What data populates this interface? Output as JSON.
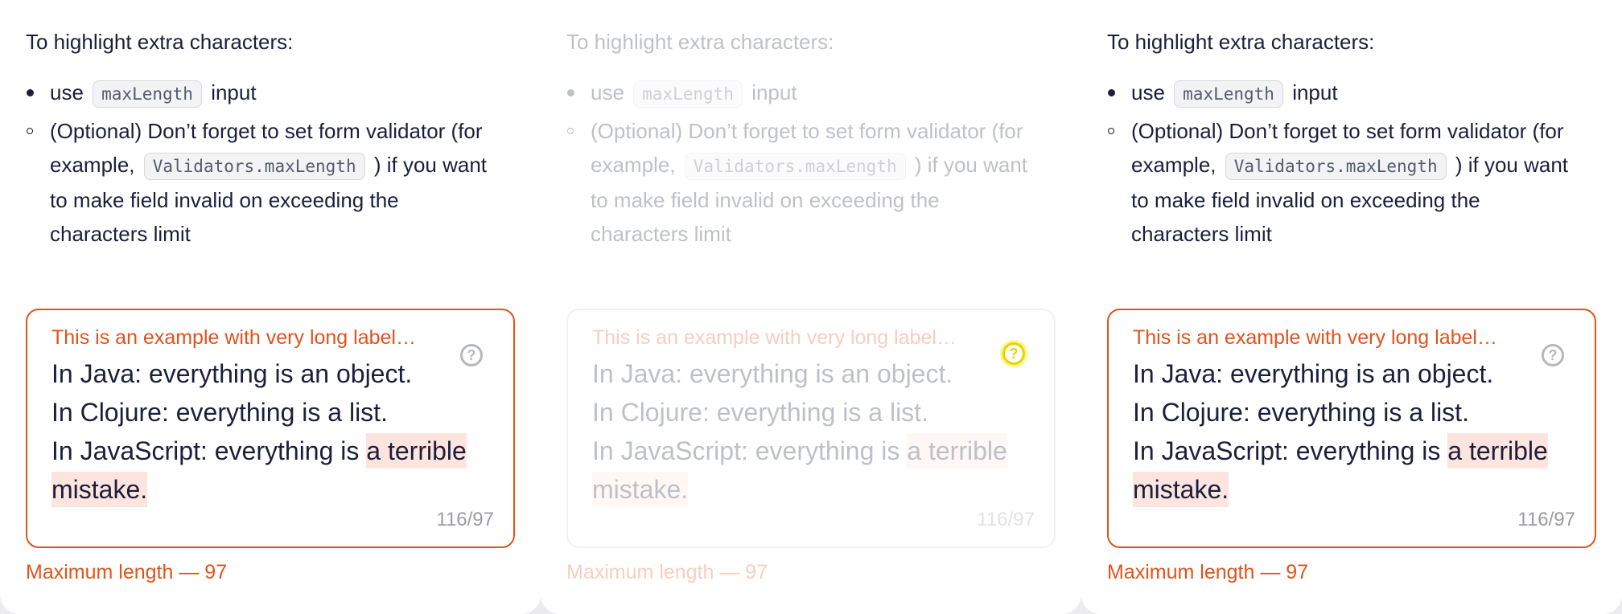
{
  "intro": "To highlight extra characters:",
  "rules": {
    "use_prefix": "use",
    "use_code": "maxLength",
    "use_suffix": "input",
    "optional_prefix": "(Optional) Don’t forget to set form validator (for example,",
    "optional_code": "Validators.maxLength",
    "optional_suffix": ") if you want to make field invalid on exceeding the characters limit"
  },
  "textarea": {
    "label": "This is an example with very long label…",
    "help_icon": "question-circle-icon",
    "line1": "In Java: everything is an object.",
    "line2": "In Clojure: everything is a list.",
    "line3_prefix": "In JavaScript: everything is ",
    "overflow_text": "a terrible mistake.",
    "counter": "116/97"
  },
  "error": "Maximum length — 97",
  "colors": {
    "error": "#e0531c",
    "overflow_highlight": "#fde4de",
    "text": "#1b1f3b",
    "hover_highlight": "#e8d200"
  }
}
